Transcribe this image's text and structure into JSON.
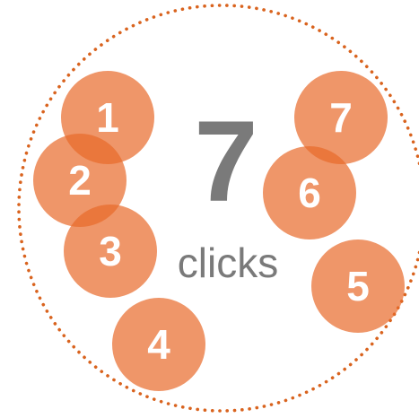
{
  "count": {
    "number": "7",
    "unit": "clicks"
  },
  "clicks": [
    {
      "label": "1"
    },
    {
      "label": "2"
    },
    {
      "label": "3"
    },
    {
      "label": "4"
    },
    {
      "label": "5"
    },
    {
      "label": "6"
    },
    {
      "label": "7"
    }
  ],
  "colors": {
    "click": "#e8692a",
    "boundary": "#d9631e",
    "count_text": "#7a7a7a"
  }
}
